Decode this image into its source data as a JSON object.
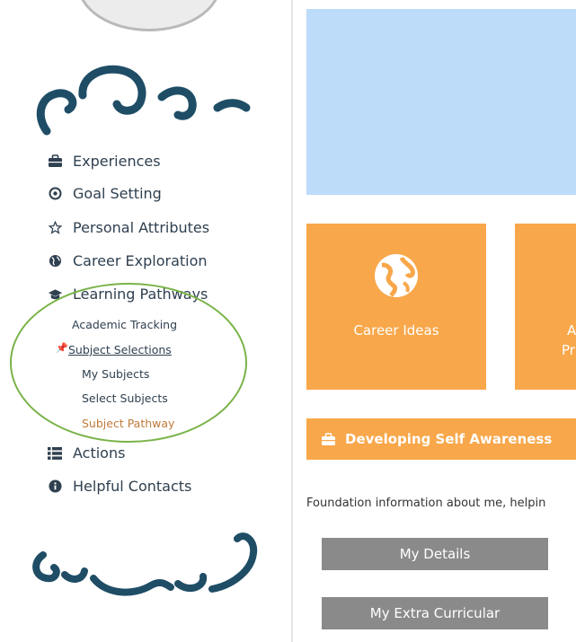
{
  "sidebar": {
    "nav": [
      {
        "label": "Experiences",
        "icon": "briefcase-icon"
      },
      {
        "label": "Goal Setting",
        "icon": "target-icon"
      },
      {
        "label": "Personal Attributes",
        "icon": "star-icon"
      },
      {
        "label": "Career Exploration",
        "icon": "globe-icon"
      },
      {
        "label": "Learning Pathways",
        "icon": "graduation-cap-icon"
      },
      {
        "label": "Actions",
        "icon": "list-icon"
      },
      {
        "label": "Helpful Contacts",
        "icon": "info-icon"
      }
    ],
    "sub": {
      "academic_tracking": "Academic Tracking",
      "subject_selections": "Subject Selections",
      "my_subjects": "My Subjects",
      "select_subjects": "Select Subjects",
      "subject_pathway": "Subject Pathway"
    },
    "active_color": "#c07a3b",
    "highlight_circle_color": "#79b348"
  },
  "main": {
    "tiles": [
      {
        "label": "Career Ideas",
        "icon": "globe-icon"
      },
      {
        "partial_line1": "A",
        "partial_line2": "Pr"
      }
    ],
    "section": {
      "title": "Developing Self Awareness",
      "icon": "briefcase-icon",
      "description": "Foundation information about me, helpin"
    },
    "buttons": {
      "my_details": "My Details",
      "my_extra_curricular": "My Extra Curricular"
    },
    "colors": {
      "accent": "#f8a74a",
      "banner": "#bcdcfa",
      "button": "#8a8a8a"
    }
  }
}
